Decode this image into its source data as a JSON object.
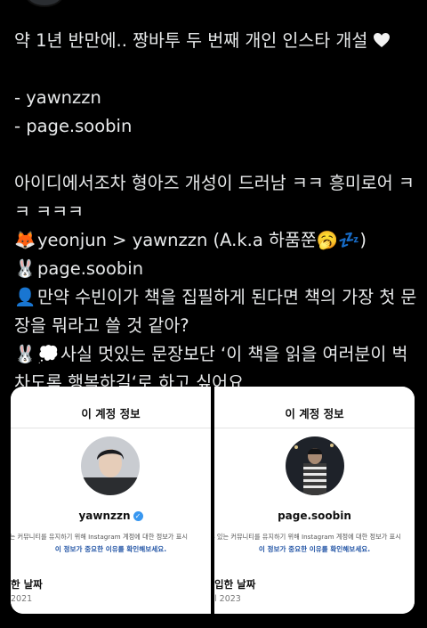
{
  "tweet": {
    "line1": "약 1년 반만에.. 짱바투 두 번째 개인 인스타 개설",
    "handle_list": [
      "- yawnzzn",
      "- page.soobin"
    ],
    "line_note1": "아이디에서조차 형아즈 개성이 드러남 ㅋㅋ 흥미로어 ㅋ",
    "line_note2": "ㅋ ㅋㅋㅋ",
    "line_fox": "yeonjun > yawnzzn (A.k.a 하품쭌",
    "line_fox_end": ")",
    "line_rabbit": "page.soobin",
    "line_q1": "만약 수빈이가 책을 집필하게 된다면 책의 가장 첫 문",
    "line_q2": "장을 뭐라고 쓸 것 같아?",
    "line_a1": "사실 멋있는 문장보단 ‘이 책을 읽을 여러분이 벅",
    "line_a2": "차도록 행복하길‘로 하고 싶어요",
    "emoji": {
      "fox": "🦊",
      "yawn": "🥱",
      "zzz": "💤",
      "rabbit": "🐰",
      "silhouette": "👤",
      "thought": "💭",
      "heart": "white-heart-icon"
    }
  },
  "cards": {
    "left": {
      "title": "이 계정 정보",
      "username": "yawnzzn",
      "verified": "✓",
      "desc": "있는 커뮤니티를 유지하기 위해 Instagram 계정에 대한 정보가 표시",
      "link": "이 정보가 중요한 이유를 확인해보세요.",
      "date_label": "한 날짜",
      "date_value": "2021"
    },
    "right": {
      "title": "이 계정 정보",
      "username": "page.soobin",
      "desc": "수 있는 커뮤니티를 유지하기 위해 Instagram 계정에 대한 정보가 표시",
      "link": "이 정보가 중요한 이유를 확인해보세요.",
      "date_label": "입한 날짜",
      "date_value": "l 2023"
    }
  },
  "colors": {
    "background": "#000000",
    "text": "#e7e9ea",
    "link": "#2456a6",
    "verified": "#3897f0"
  }
}
